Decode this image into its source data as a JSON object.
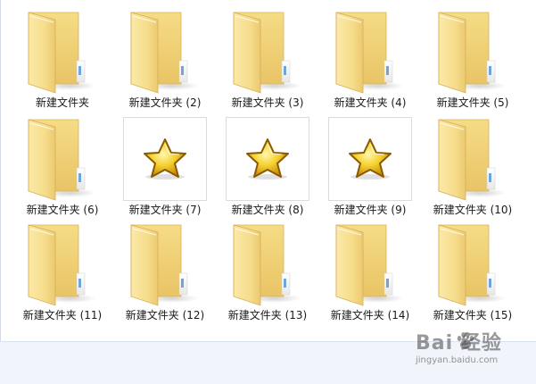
{
  "items": [
    {
      "label": "新建文件夹",
      "type": "folder"
    },
    {
      "label": "新建文件夹 (2)",
      "type": "folder"
    },
    {
      "label": "新建文件夹 (3)",
      "type": "folder"
    },
    {
      "label": "新建文件夹 (4)",
      "type": "folder"
    },
    {
      "label": "新建文件夹 (5)",
      "type": "folder"
    },
    {
      "label": "新建文件夹 (6)",
      "type": "folder"
    },
    {
      "label": "新建文件夹 (7)",
      "type": "star"
    },
    {
      "label": "新建文件夹 (8)",
      "type": "star"
    },
    {
      "label": "新建文件夹 (9)",
      "type": "star"
    },
    {
      "label": "新建文件夹 (10)",
      "type": "folder"
    },
    {
      "label": "新建文件夹 (11)",
      "type": "folder"
    },
    {
      "label": "新建文件夹 (12)",
      "type": "folder"
    },
    {
      "label": "新建文件夹 (13)",
      "type": "folder"
    },
    {
      "label": "新建文件夹 (14)",
      "type": "folder"
    },
    {
      "label": "新建文件夹 (15)",
      "type": "folder"
    }
  ],
  "icons": {
    "folder": "folder-icon",
    "star": "star-icon"
  },
  "watermark": {
    "text": "Bai 经验",
    "url": "jingyan.baidu.com"
  }
}
